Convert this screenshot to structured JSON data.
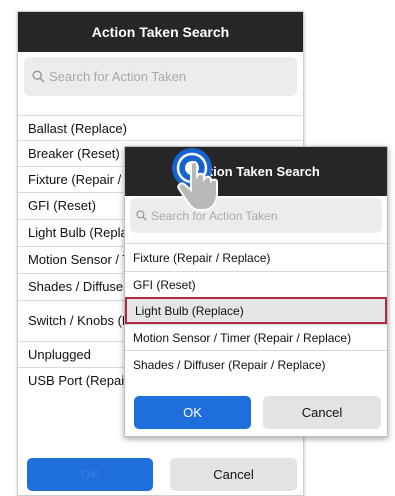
{
  "back_dialog": {
    "title": "Action Taken Search",
    "search_placeholder": "Search for Action Taken",
    "items": [
      {
        "label": "Ballast (Replace)"
      },
      {
        "label": "Breaker (Reset)"
      },
      {
        "label": "Fixture (Repair / Replace)"
      },
      {
        "label": "GFI (Reset)"
      },
      {
        "label": "Light Bulb (Replace)"
      },
      {
        "label": "Motion Sensor / Timer (Repair / Replace)"
      },
      {
        "label": "Shades / Diffuser (Repair / Replace)"
      },
      {
        "label": "Switch / Knobs (Repair / Replace)"
      },
      {
        "label": "Unplugged"
      },
      {
        "label": "USB Port (Repair / Replace)"
      }
    ],
    "ok_label": "OK",
    "cancel_label": "Cancel"
  },
  "front_dialog": {
    "title": "Action Taken Search",
    "search_placeholder": "Search for Action Taken",
    "items": [
      {
        "label": "Fixture (Repair / Replace)"
      },
      {
        "label": "GFI (Reset)"
      },
      {
        "label": "Light Bulb (Replace)",
        "selected": true
      },
      {
        "label": "Motion Sensor / Timer (Repair / Replace)"
      },
      {
        "label": "Shades / Diffuser (Repair / Replace)"
      }
    ],
    "ok_label": "OK",
    "cancel_label": "Cancel"
  },
  "colors": {
    "header": "#262629",
    "ok_button": "#1e6fdb",
    "selected_border": "#b02a42",
    "tap_indicator": "#1565d8"
  },
  "icons": {
    "search": "search-icon",
    "touch": "hand-pointer-icon"
  }
}
